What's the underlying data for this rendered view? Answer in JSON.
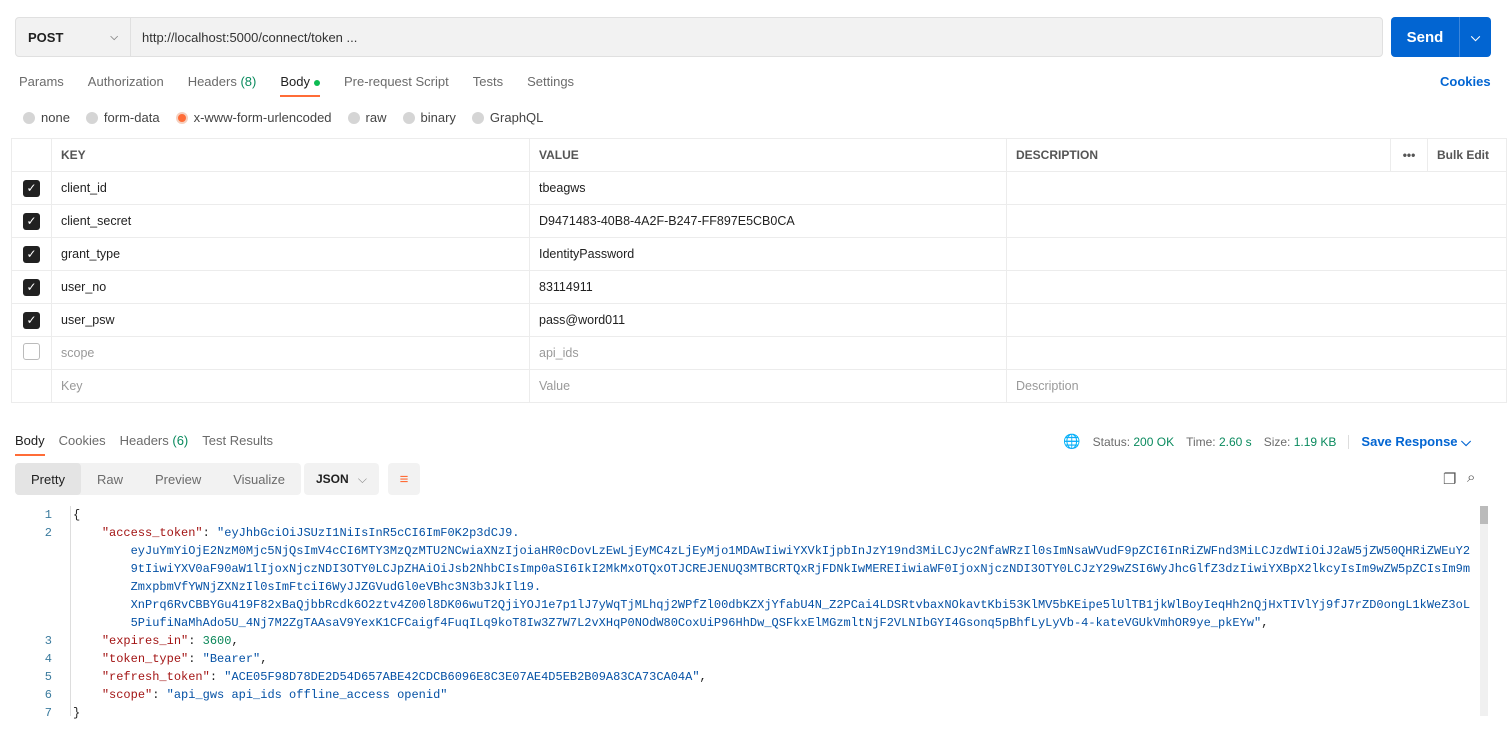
{
  "request": {
    "method": "POST",
    "url": "http://localhost:5000/connect/token ...",
    "send_label": "Send"
  },
  "req_tabs": [
    {
      "label": "Params"
    },
    {
      "label": "Authorization"
    },
    {
      "label": "Headers ",
      "count": "(8)"
    },
    {
      "label": "Body"
    },
    {
      "label": "Pre-request Script"
    },
    {
      "label": "Tests"
    },
    {
      "label": "Settings"
    }
  ],
  "cookies_link": "Cookies",
  "body_types": [
    {
      "label": "none"
    },
    {
      "label": "form-data"
    },
    {
      "label": "x-www-form-urlencoded",
      "selected": true
    },
    {
      "label": "raw"
    },
    {
      "label": "binary"
    },
    {
      "label": "GraphQL"
    }
  ],
  "params_table": {
    "headers": [
      "KEY",
      "VALUE",
      "DESCRIPTION"
    ],
    "more": "•••",
    "bulk_edit": "Bulk Edit",
    "rows": [
      {
        "key": "client_id",
        "value": "tbeagws",
        "checked": true
      },
      {
        "key": "client_secret",
        "value": "D9471483-40B8-4A2F-B247-FF897E5CB0CA",
        "checked": true
      },
      {
        "key": "grant_type",
        "value": "IdentityPassword",
        "checked": true
      },
      {
        "key": "user_no",
        "value": "83114911",
        "checked": true
      },
      {
        "key": "user_psw",
        "value": "pass@word011",
        "checked": true
      },
      {
        "key": "scope",
        "value": "api_ids",
        "checked": false
      }
    ],
    "placeholder": {
      "key": "Key",
      "value": "Value",
      "description": "Description"
    }
  },
  "resp_tabs": [
    {
      "label": "Body"
    },
    {
      "label": "Cookies"
    },
    {
      "label": "Headers ",
      "count": "(6)"
    },
    {
      "label": "Test Results"
    }
  ],
  "status": {
    "status_label": "Status:",
    "status": "200 OK",
    "time_label": "Time:",
    "time": "2.60 s",
    "size_label": "Size:",
    "size": "1.19 KB",
    "save": "Save Response"
  },
  "views": [
    "Pretty",
    "Raw",
    "Preview",
    "Visualize"
  ],
  "format": "JSON",
  "code": {
    "open": "{",
    "close": "}",
    "access_token_key": "\"access_token\"",
    "access_token_lines": [
      "\"eyJhbGciOiJSUzI1NiIsInR5cCI6ImF0K2p3dCJ9.",
      "eyJuYmYiOjE2NzM0Mjc5NjQsImV4cCI6MTY3MzQzMTU2NCwiaXNzIjoiaHR0cDovLzEwLjEyMC4zLjEyMjo1MDAwIiwiYXVkIjpbInJzY19nd3MiLCJyc2NfaWRzIl0sImNsaWVudF9pZCI6InRiZWFnd3MiLCJzdWIiOiJ2aW5jZW50QHRiZWEuY2",
      "9tIiwiYXV0aF90aW1lIjoxNjczNDI3OTY0LCJpZHAiOiJsb2NhbCIsImp0aSI6IkI2MkMxOTQxOTJCREJENUQ3MTBCRTQxRjFDNkIwMEREIiwiaWF0IjoxNjczNDI3OTY0LCJzY29wZSI6WyJhcGlfZ3dzIiwiYXBpX2lkcyIsIm9wZW5pZCIsIm9m",
      "ZmxpbmVfYWNjZXNzIl0sImFtciI6WyJJZGVudGl0eVBhc3N3b3JkIl19.",
      "XnPrq6RvCBBYGu419F82xBaQjbbRcdk6O2ztv4Z00l8DK06wuT2QjiYOJ1e7p1lJ7yWqTjMLhqj2WPfZl00dbKZXjYfabU4N_Z2PCai4LDSRtvbaxNOkavtKbi53KlMV5bKEipe5lUlTB1jkWlBoyIeqHh2nQjHxTIVlYj9fJ7rZD0ongL1kWeZ3oL",
      "5PiufiNaMhAdo5U_4Nj7M2ZgTAAsaV9YexK1CFCaigf4FuqILq9koT8Iw3Z7W7L2vXHqP0NOdW80CoxUiP96HhDw_QSFkxElMGzmltNjF2VLNIbGYI4Gsonq5pBhfLyLyVb-4-kateVGUkVmhOR9ye_pkEYw\""
    ],
    "expires_in_key": "\"expires_in\"",
    "expires_in": "3600",
    "token_type_key": "\"token_type\"",
    "token_type": "\"Bearer\"",
    "refresh_token_key": "\"refresh_token\"",
    "refresh_token": "\"ACE05F98D78DE2D54D657ABE42CDCB6096E8C3E07AE4D5EB2B09A83CA73CA04A\"",
    "scope_key": "\"scope\"",
    "scope": "\"api_gws api_ids offline_access openid\""
  },
  "colors": {
    "accent": "#ff6c37",
    "send": "#0265d2",
    "success": "#0a8a5e"
  }
}
